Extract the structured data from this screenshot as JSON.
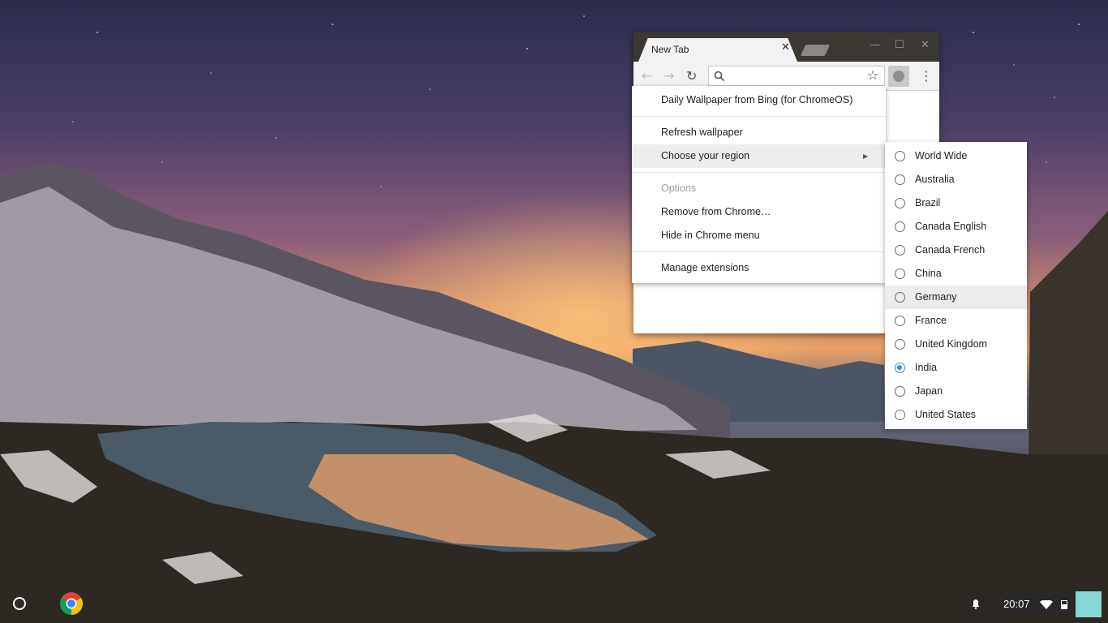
{
  "browser": {
    "tab_title": "New Tab",
    "tab_close": "✕",
    "window_controls": {
      "minimize": "—",
      "maximize": "☐",
      "close": "✕"
    },
    "toolbar": {
      "back": "←",
      "forward": "→",
      "reload": "↻",
      "search_icon": "search-icon",
      "bookmark": "☆",
      "menu": "⋮"
    }
  },
  "context_menu": {
    "extension_name": "Daily Wallpaper from Bing (for ChromeOS)",
    "refresh": "Refresh wallpaper",
    "choose_region": "Choose your region",
    "options": "Options",
    "remove": "Remove from Chrome…",
    "hide": "Hide in Chrome menu",
    "manage": "Manage extensions"
  },
  "region_submenu": {
    "selected": "India",
    "hovered": "Germany",
    "items": [
      {
        "label": "World Wide"
      },
      {
        "label": "Australia"
      },
      {
        "label": "Brazil"
      },
      {
        "label": "Canada English"
      },
      {
        "label": "Canada French"
      },
      {
        "label": "China"
      },
      {
        "label": "Germany"
      },
      {
        "label": "France"
      },
      {
        "label": "United Kingdom"
      },
      {
        "label": "India"
      },
      {
        "label": "Japan"
      },
      {
        "label": "United States"
      }
    ]
  },
  "shelf": {
    "clock": "20:07",
    "colors": {
      "avatar": "#86d8d6",
      "radio_checked": "#4285f4"
    }
  }
}
